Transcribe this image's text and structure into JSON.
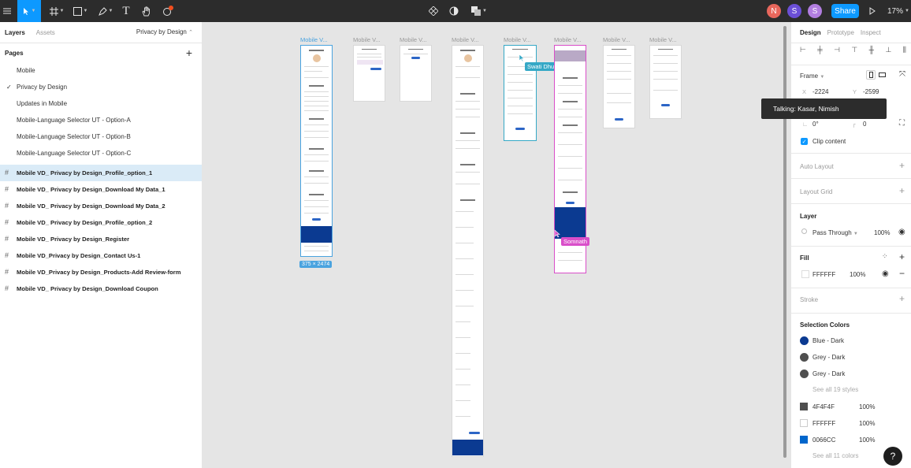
{
  "toolbar": {
    "menu_icon": "hamburger-menu-icon",
    "tools": [
      "move",
      "frame",
      "shape",
      "pen",
      "text",
      "hand",
      "comment"
    ],
    "text_tool_glyph": "T",
    "avatars": [
      "N",
      "S",
      "S"
    ],
    "share_label": "Share",
    "zoom": "17%"
  },
  "left_panel": {
    "tabs": [
      "Layers",
      "Assets"
    ],
    "current_page": "Privacy by Design",
    "pages_title": "Pages",
    "pages": [
      "Mobile",
      "Privacy by Design",
      "Updates in Mobile",
      "Mobile-Language Selector UT - Option-A",
      "Mobile-Language Selector UT - Option-B",
      "Mobile-Language Selector UT - Option-C"
    ],
    "layers": [
      "Mobile VD_ Privacy by Design_Profile_option_1",
      "Mobile VD_ Privacy by Design_Download My Data_1",
      "Mobile VD_ Privacy by Design_Download My Data_2",
      "Mobile VD_ Privacy by Design_Profile_option_2",
      "Mobile VD_ Privacy by Design_Register",
      "Mobile VD_Privacy by Design_Contact Us-1",
      "Mobile VD_Privacy by Design_Products-Add Review-form",
      "Mobile VD_ Privacy by Design_Download Coupon"
    ]
  },
  "canvas": {
    "frame_labels": [
      "Mobile V...",
      "Mobile V...",
      "Mobile V...",
      "Mobile V...",
      "Mobile V...",
      "Mobile V...",
      "Mobile V...",
      "Mobile V..."
    ],
    "size_badge": "375 × 2474",
    "cursors": {
      "swati": "Swati Dhuri",
      "somnath": "Somnath"
    },
    "colors": {
      "selection": "#4aa3df",
      "collab_teal": "#35a8c6",
      "collab_pink": "#d94ec9",
      "brand_blue": "#0b3a91"
    }
  },
  "tooltip": "Talking: Kasar, Nimish",
  "right_panel": {
    "tabs": [
      "Design",
      "Prototype",
      "Inspect"
    ],
    "frame_label": "Frame",
    "x_label": "X",
    "x_value": "-2224",
    "y_label": "Y",
    "y_value": "-2599",
    "rotation": "0°",
    "radius": "0",
    "clip_content": "Clip content",
    "auto_layout": "Auto Layout",
    "layout_grid": "Layout Grid",
    "layer_title": "Layer",
    "blend_mode": "Pass Through",
    "layer_opacity": "100%",
    "fill_title": "Fill",
    "fill_hex": "FFFFFF",
    "fill_opacity": "100%",
    "stroke_title": "Stroke",
    "selection_colors_title": "Selection Colors",
    "styles": [
      {
        "name": "Blue - Dark",
        "color": "#0b3a91"
      },
      {
        "name": "Grey - Dark",
        "color": "#4f4f4f"
      },
      {
        "name": "Grey - Dark",
        "color": "#4f4f4f"
      }
    ],
    "see_all_styles": "See all 19 styles",
    "colors": [
      {
        "hex": "4F4F4F",
        "opacity": "100%",
        "color": "#4f4f4f"
      },
      {
        "hex": "FFFFFF",
        "opacity": "100%",
        "color": "#ffffff"
      },
      {
        "hex": "0066CC",
        "opacity": "100%",
        "color": "#0066cc"
      }
    ],
    "see_all_colors": "See all 11 colors"
  },
  "help_glyph": "?"
}
